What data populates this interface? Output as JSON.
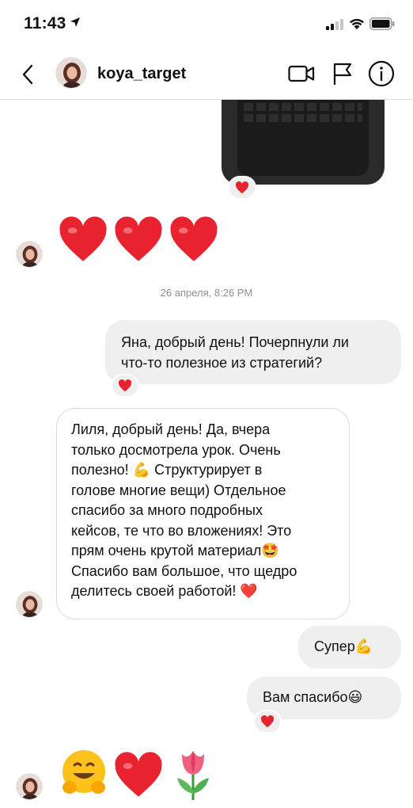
{
  "status_bar": {
    "time": "11:43"
  },
  "header": {
    "username": "koya_target"
  },
  "timestamp": "26 апреля, 8:26 PM",
  "messages": {
    "out1": "Яна, добрый день! Почерпнули ли\nчто-то полезное из стратегий?",
    "in1": "Лиля, добрый день! Да, вчера\nтолько досмотрела урок. Очень\nполезно! 💪 Структурирует в\nголове многие вещи) Отдельное\nспасибо за много подробных\nкейсов, те что во вложениях! Это\nпрям очень крутой материал🤩\nСпасибо вам большое, что щедро\nделитесь своей работой! ❤️",
    "out2": "Супер💪",
    "out3": "Вам спасибо😃"
  },
  "icons": {
    "back": "chevron-left-icon",
    "video": "video-call-icon",
    "flag": "flag-icon",
    "info": "info-icon",
    "heart": "red-heart-emoji",
    "hug": "hugging-face-emoji",
    "tulip": "tulip-emoji"
  },
  "colors": {
    "heart": "#e8232f",
    "bubble_out": "#efefef",
    "border": "#dbdbdb",
    "timestamp": "#8e8e8e"
  }
}
